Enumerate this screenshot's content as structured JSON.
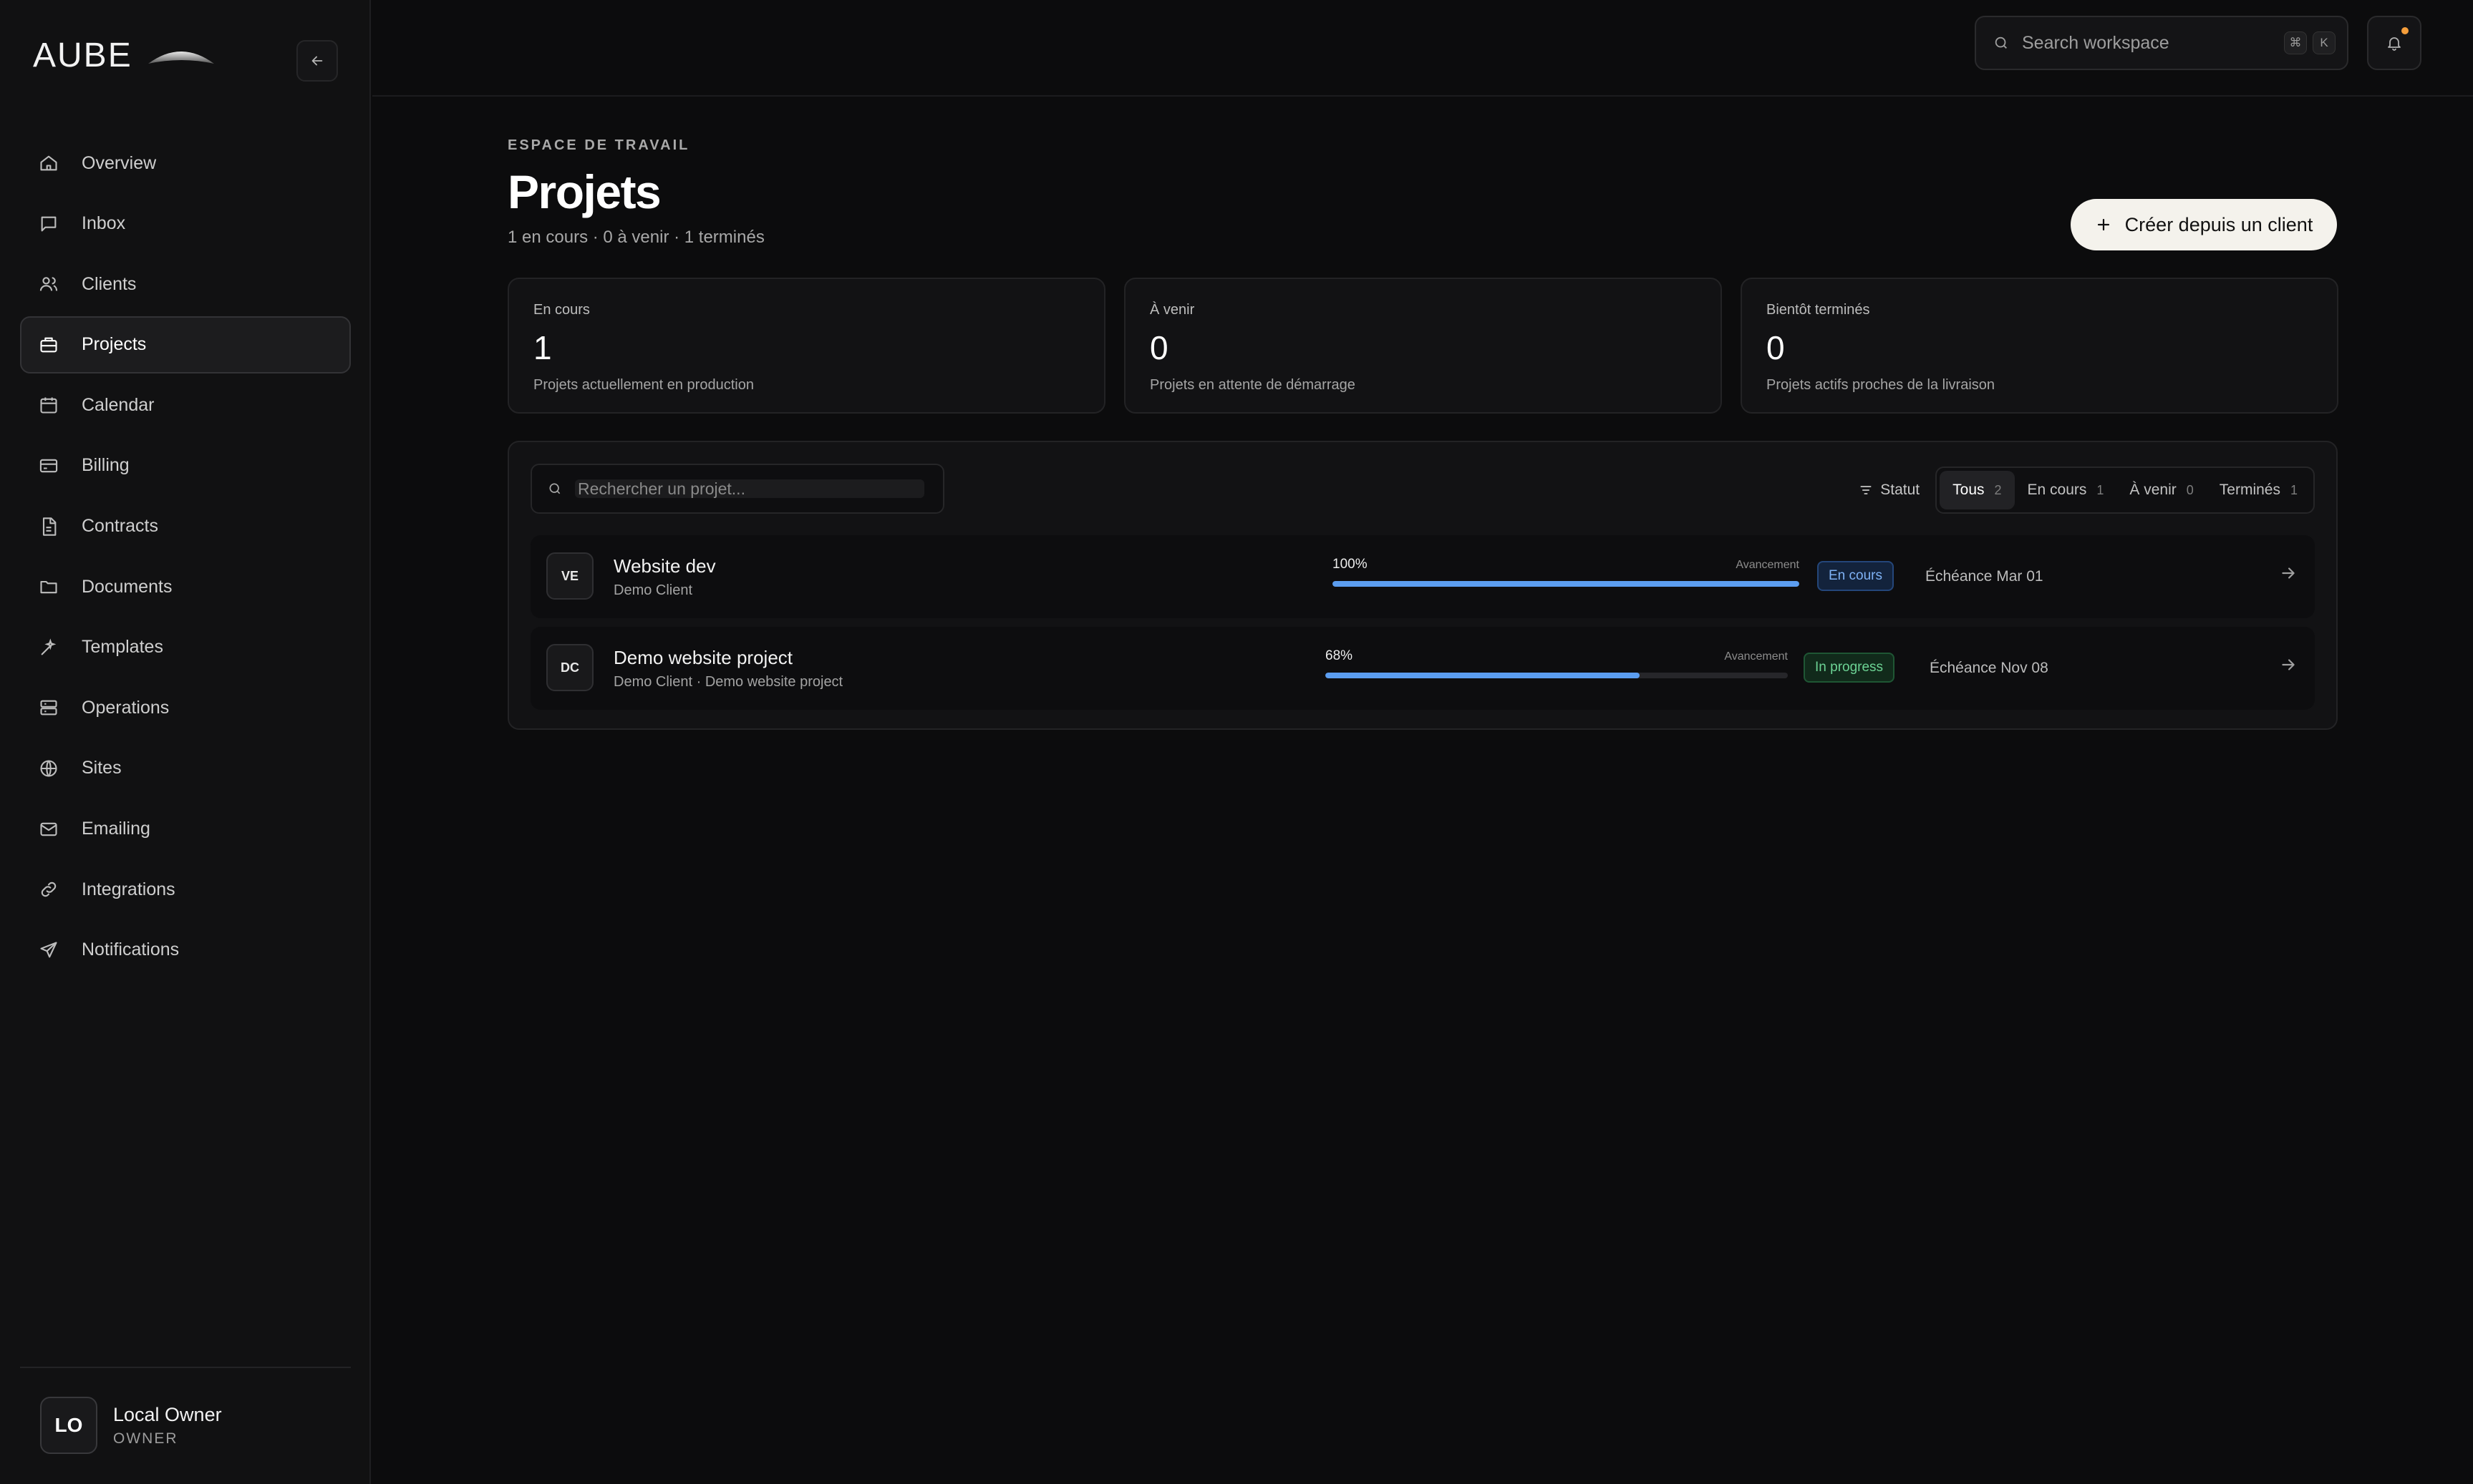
{
  "brand": {
    "name": "AUBE"
  },
  "nav": {
    "items": [
      {
        "label": "Overview",
        "icon": "home-icon",
        "active": false
      },
      {
        "label": "Inbox",
        "icon": "message-icon",
        "active": false
      },
      {
        "label": "Clients",
        "icon": "users-icon",
        "active": false
      },
      {
        "label": "Projects",
        "icon": "briefcase-icon",
        "active": true
      },
      {
        "label": "Calendar",
        "icon": "calendar-icon",
        "active": false
      },
      {
        "label": "Billing",
        "icon": "credit-card-icon",
        "active": false
      },
      {
        "label": "Contracts",
        "icon": "file-text-icon",
        "active": false
      },
      {
        "label": "Documents",
        "icon": "folder-icon",
        "active": false
      },
      {
        "label": "Templates",
        "icon": "sparkle-icon",
        "active": false
      },
      {
        "label": "Operations",
        "icon": "server-icon",
        "active": false
      },
      {
        "label": "Sites",
        "icon": "globe-icon",
        "active": false
      },
      {
        "label": "Emailing",
        "icon": "mail-icon",
        "active": false
      },
      {
        "label": "Integrations",
        "icon": "link-icon",
        "active": false
      },
      {
        "label": "Notifications",
        "icon": "send-icon",
        "active": false
      }
    ]
  },
  "user": {
    "initials": "LO",
    "name": "Local Owner",
    "role": "OWNER"
  },
  "topbar": {
    "search_placeholder": "Search workspace",
    "shortcut_keys": [
      "⌘",
      "K"
    ],
    "notification_dot_color": "#f59e3b"
  },
  "header": {
    "eyebrow": "ESPACE DE TRAVAIL",
    "title": "Projets",
    "subtitle": "1 en cours · 0 à venir · 1 terminés",
    "create_button": "Créer depuis un client"
  },
  "stats": [
    {
      "label": "En cours",
      "value": "1",
      "desc": "Projets actuellement en production"
    },
    {
      "label": "À venir",
      "value": "0",
      "desc": "Projets en attente de démarrage"
    },
    {
      "label": "Bientôt terminés",
      "value": "0",
      "desc": "Projets actifs proches de la livraison"
    }
  ],
  "filters": {
    "search_placeholder": "Rechercher un projet...",
    "status_label": "Statut",
    "segments": [
      {
        "label": "Tous",
        "count": "2",
        "active": true
      },
      {
        "label": "En cours",
        "count": "1",
        "active": false
      },
      {
        "label": "À venir",
        "count": "0",
        "active": false
      },
      {
        "label": "Terminés",
        "count": "1",
        "active": false
      }
    ]
  },
  "projects": [
    {
      "initials": "VE",
      "title": "Website dev",
      "subtitle": "Demo Client",
      "progress_pct": "100%",
      "progress_value": 100,
      "progress_label": "Avancement",
      "status": "En cours",
      "status_color": "#7fb2f5",
      "due": "Échéance Mar 01"
    },
    {
      "initials": "DC",
      "title": "Demo website project",
      "subtitle": "Demo Client · Demo website project",
      "progress_pct": "68%",
      "progress_value": 68,
      "progress_label": "Avancement",
      "status": "In progress",
      "status_color": "#6cd394",
      "due": "Échéance Nov 08"
    }
  ],
  "colors": {
    "accent": "#5b9df0",
    "background": "#0c0c0d",
    "sidebar": "#111112"
  }
}
